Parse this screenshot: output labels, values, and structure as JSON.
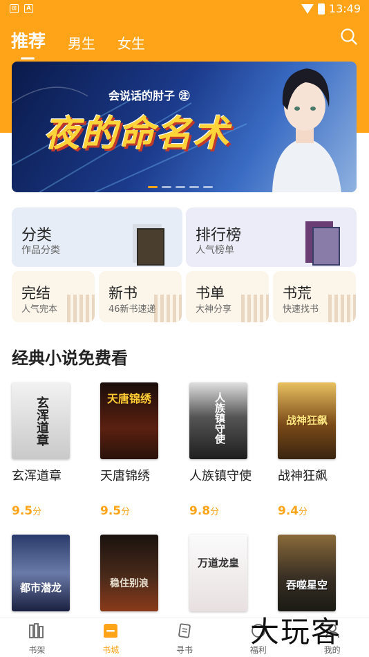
{
  "status": {
    "time": "13:49"
  },
  "tabs": [
    {
      "label": "推荐",
      "active": true
    },
    {
      "label": "男生",
      "active": false
    },
    {
      "label": "女生",
      "active": false
    }
  ],
  "banner": {
    "author": "会说话的肘子 ㊟",
    "title": "夜的命名术",
    "dots": 5,
    "active_dot": 0
  },
  "categories": [
    {
      "title": "分类",
      "subtitle": "作品分类"
    },
    {
      "title": "排行榜",
      "subtitle": "人气榜单"
    }
  ],
  "shortcuts": [
    {
      "title": "完结",
      "subtitle": "人气完本"
    },
    {
      "title": "新书",
      "subtitle": "46新书速递"
    },
    {
      "title": "书单",
      "subtitle": "大神分享"
    },
    {
      "title": "书荒",
      "subtitle": "快速找书"
    }
  ],
  "section": {
    "title": "经典小说免费看"
  },
  "books": [
    {
      "title": "玄浑道章",
      "score": "9.5",
      "unit": "分",
      "cover_text": "玄浑道章"
    },
    {
      "title": "天唐锦绣",
      "score": "9.5",
      "unit": "分",
      "cover_text": "天唐锦绣"
    },
    {
      "title": "人族镇守使",
      "score": "9.8",
      "unit": "分",
      "cover_text": "人族镇守使"
    },
    {
      "title": "战神狂飙",
      "score": "9.4",
      "unit": "分",
      "cover_text": "战神狂飙"
    },
    {
      "title": "",
      "score": "",
      "unit": "",
      "cover_text": "都市潜龙"
    },
    {
      "title": "",
      "score": "",
      "unit": "",
      "cover_text": "稳住别浪"
    },
    {
      "title": "",
      "score": "",
      "unit": "",
      "cover_text": "万道龙皇"
    },
    {
      "title": "",
      "score": "",
      "unit": "",
      "cover_text": "吞噬星空"
    }
  ],
  "nav": [
    {
      "label": "书架",
      "icon": "bookshelf-icon"
    },
    {
      "label": "书城",
      "icon": "bookstore-icon",
      "active": true
    },
    {
      "label": "寻书",
      "icon": "find-book-icon"
    },
    {
      "label": "福利",
      "icon": "welfare-icon"
    },
    {
      "label": "我的",
      "icon": "profile-icon"
    }
  ],
  "watermark": "大玩客",
  "colors": {
    "accent": "#FFA419",
    "category_blue": "#E6EDF7",
    "category_purple": "#EBECF8",
    "shortcut_bg": "#FCF6EA"
  }
}
